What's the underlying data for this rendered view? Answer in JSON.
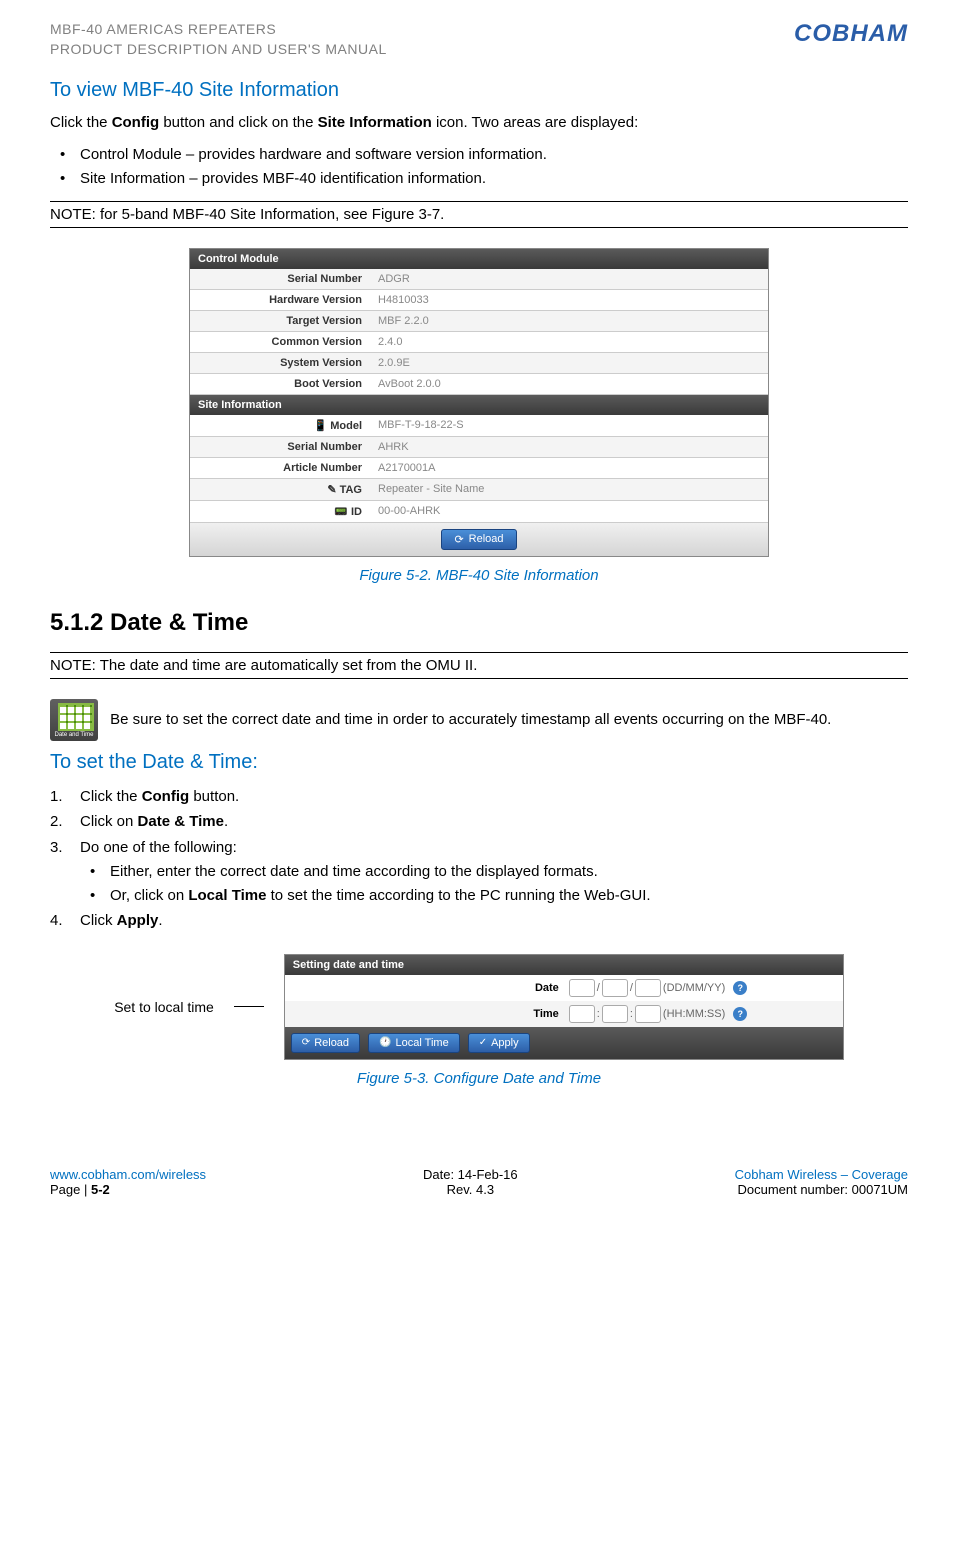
{
  "header": {
    "line1": "MBF-40 AMERICAS REPEATERS",
    "line2": "PRODUCT DESCRIPTION AND USER'S MANUAL",
    "logo": "COBHAM"
  },
  "section1": {
    "heading": "To view MBF-40 Site Information",
    "intro": "Click the Config button and click on the Site Information icon. Two areas are displayed:",
    "intro_parts": {
      "p1": "Click the ",
      "b1": "Config",
      "p2": " button and click on the ",
      "b2": "Site Information",
      "p3": " icon. Two areas are displayed:"
    },
    "bullets": [
      "Control Module – provides hardware and software version information.",
      "Site Information – provides MBF-40 identification information."
    ],
    "note": "NOTE: for 5-band MBF-40 Site Information, see Figure 3-7."
  },
  "panel1": {
    "section_a_title": "Control Module",
    "rows_a": [
      {
        "label": "Serial Number",
        "value": "ADGR"
      },
      {
        "label": "Hardware Version",
        "value": "H4810033"
      },
      {
        "label": "Target Version",
        "value": "MBF 2.2.0"
      },
      {
        "label": "Common Version",
        "value": "2.4.0"
      },
      {
        "label": "System Version",
        "value": "2.0.9E"
      },
      {
        "label": "Boot Version",
        "value": "AvBoot 2.0.0"
      }
    ],
    "section_b_title": "Site Information",
    "rows_b": [
      {
        "label": "📱 Model",
        "value": "MBF-T-9-18-22-S"
      },
      {
        "label": "Serial Number",
        "value": "AHRK"
      },
      {
        "label": "Article Number",
        "value": "A2170001A"
      },
      {
        "label": "✎ TAG",
        "value": "Repeater - Site Name"
      },
      {
        "label": "📟 ID",
        "value": "00-00-AHRK"
      }
    ],
    "reload_label": "Reload",
    "caption": "Figure 5-2. MBF-40 Site Information"
  },
  "section2": {
    "heading": "5.1.2  Date & Time",
    "note": "NOTE: The date and time are automatically set from the OMU II.",
    "icon_desc": " Be sure to set the correct date and time in order to accurately timestamp all events occurring on the MBF-40.",
    "sub_heading": "To set the Date & Time:",
    "steps": {
      "s1": {
        "p1": "Click the ",
        "b1": "Config",
        "p2": " button."
      },
      "s2": {
        "p1": "Click on ",
        "b1": "Date & Time",
        "p2": "."
      },
      "s3": {
        "p1": "Do one of the following:"
      },
      "s3_sub": [
        "Either, enter the correct date and time according to the displayed formats.",
        {
          "p1": "Or, click on ",
          "b1": "Local Time",
          "p2": " to set the time according to the PC running the Web-GUI."
        }
      ],
      "s4": {
        "p1": "Click ",
        "b1": "Apply",
        "p2": "."
      }
    }
  },
  "panel2": {
    "local_time_label": "Set to local time",
    "title": "Setting date and time",
    "date_label": "Date",
    "date_hint": "(DD/MM/YY)",
    "time_label": "Time",
    "time_hint": "(HH:MM:SS)",
    "btn_reload": "Reload",
    "btn_local": "Local Time",
    "btn_apply": "Apply",
    "caption": "Figure 5-3. Configure Date and Time"
  },
  "footer": {
    "url": "www.cobham.com/wireless",
    "page_pre": "Page | ",
    "page": "5-2",
    "date": "Date: 14-Feb-16",
    "rev": "Rev. 4.3",
    "company": "Cobham Wireless – Coverage",
    "docnum": "Document number: 00071UM"
  }
}
